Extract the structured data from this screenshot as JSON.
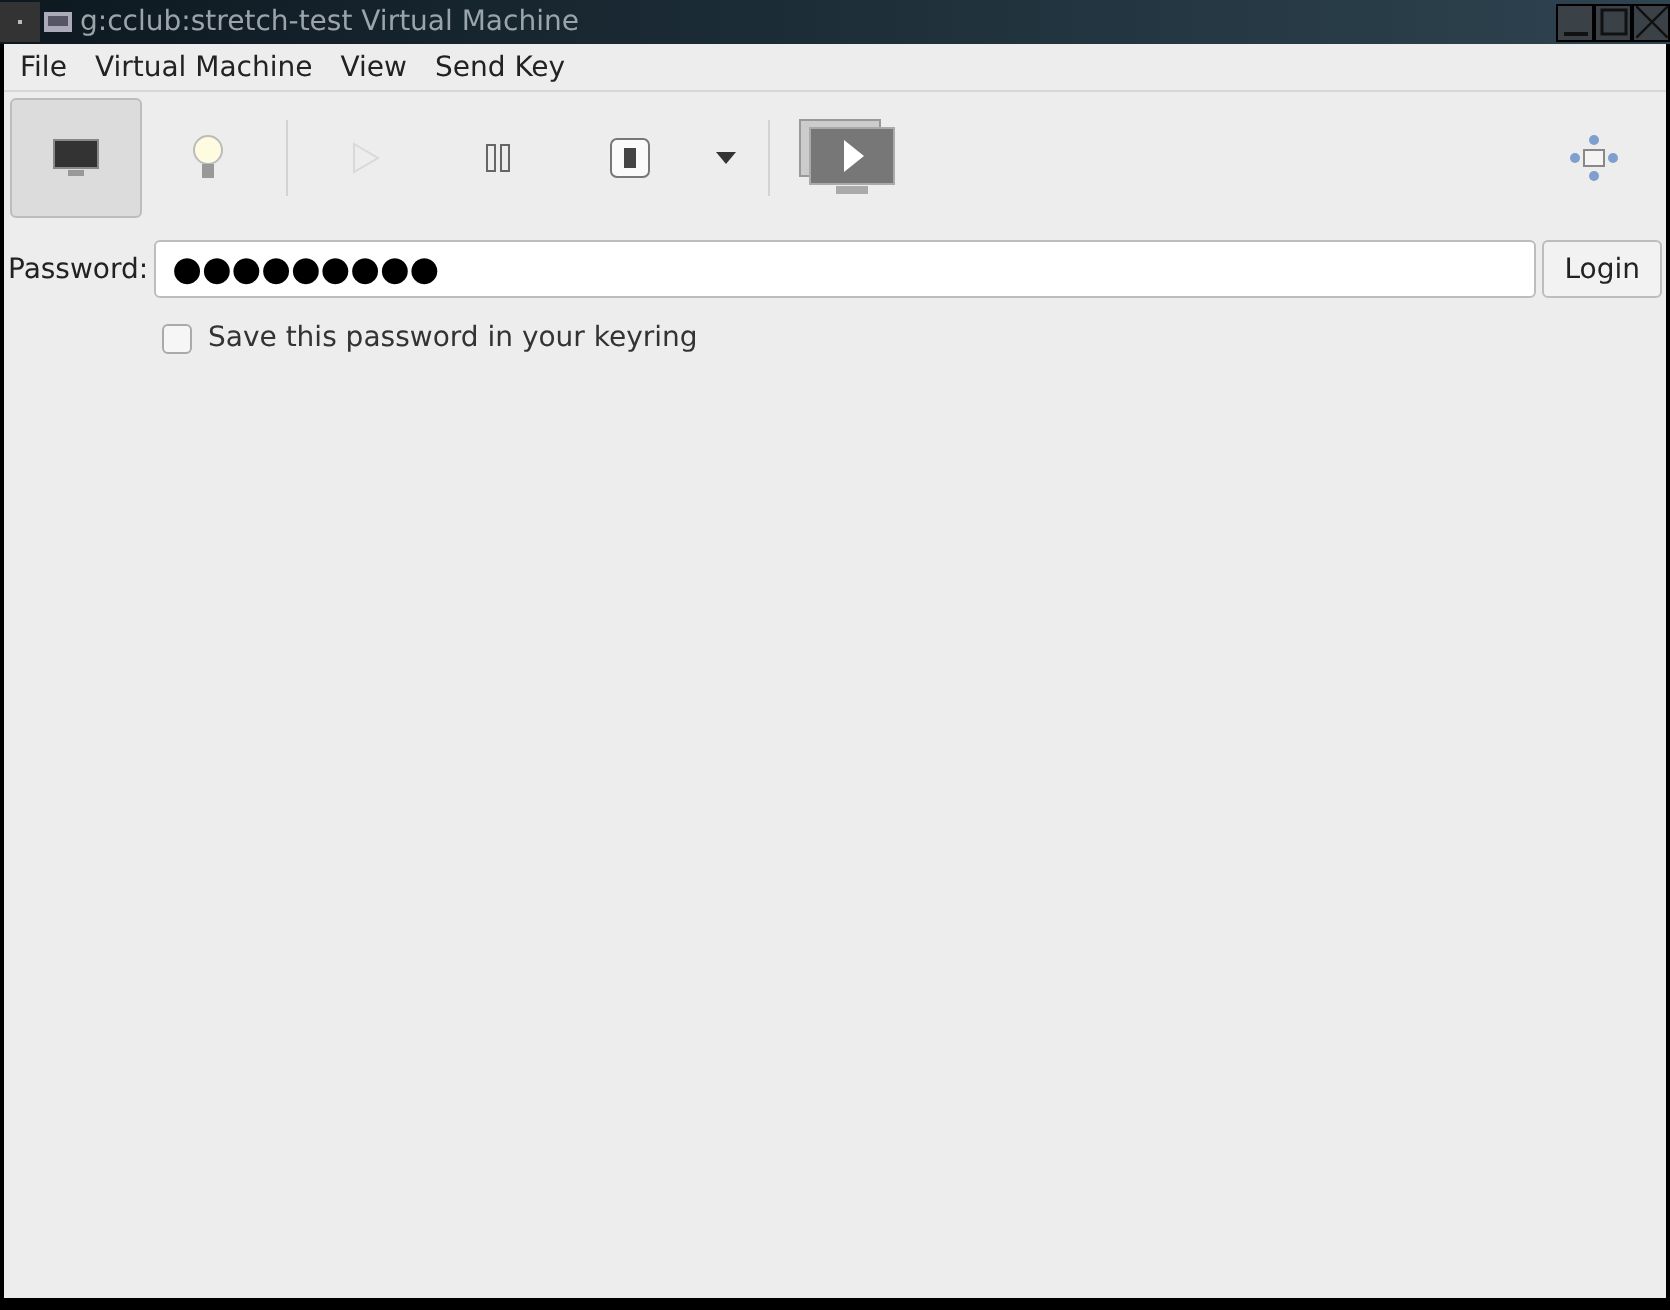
{
  "window": {
    "title": "g:cclub:stretch-test Virtual Machine"
  },
  "menu": [
    "File",
    "Virtual Machine",
    "View",
    "Send Key"
  ],
  "toolbar": [
    {
      "kind": "console",
      "selected": true,
      "disabled": false
    },
    {
      "kind": "details",
      "selected": false,
      "disabled": false
    },
    {
      "kind": "sep"
    },
    {
      "kind": "run",
      "selected": false,
      "disabled": true
    },
    {
      "kind": "pause",
      "selected": false,
      "disabled": false
    },
    {
      "kind": "shutdown",
      "selected": false,
      "disabled": false
    },
    {
      "kind": "menu",
      "selected": false,
      "disabled": false
    },
    {
      "kind": "sep"
    },
    {
      "kind": "fullscreen",
      "selected": false,
      "disabled": false
    },
    {
      "kind": "spacer"
    },
    {
      "kind": "resize",
      "selected": false,
      "disabled": false
    }
  ],
  "login": {
    "label": "Password:",
    "value": "●●●●●●●●●",
    "button": "Login"
  },
  "save": {
    "label": "Save this password in your keyring",
    "checked": false
  }
}
